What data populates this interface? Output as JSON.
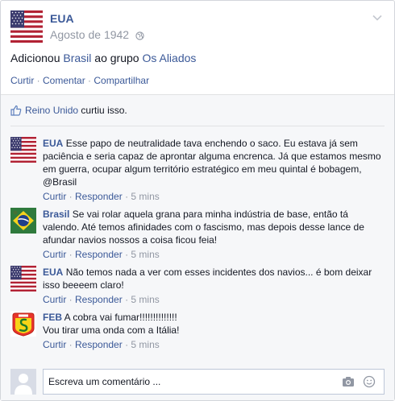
{
  "post": {
    "author": "EUA",
    "date": "Agosto de 1942",
    "story": {
      "prefix": "Adicionou",
      "friend": "Brasil",
      "middle": "ao grupo",
      "group": "Os Aliados"
    },
    "actions": {
      "like": "Curtir",
      "sep": " · ",
      "comment": "Comentar",
      "share": "Compartilhar"
    }
  },
  "likes": {
    "name": "Reino Unido",
    "suffix": "curtiu isso."
  },
  "comments": [
    {
      "author": "EUA",
      "text": "Esse papo de neutralidade tava enchendo o saco. Eu estava já sem paciência e seria capaz de aprontar alguma encrenca. Já que estamos mesmo em guerra, ocupar algum território estratégico em meu quintal é bobagem, @Brasil",
      "like": "Curtir",
      "reply": "Responder",
      "time": "5 mins"
    },
    {
      "author": "Brasil",
      "text": "Se vai rolar aquela grana para minha indústria de base, então tá valendo. Até temos afinidades com o fascismo, mas depois desse lance de afundar navios nossos a coisa ficou feia!",
      "like": "Curtir",
      "reply": "Responder",
      "time": "5 mins"
    },
    {
      "author": "EUA",
      "text": "Não temos nada a ver com esses incidentes dos navios... é bom deixar isso beeeem claro!",
      "like": "Curtir",
      "reply": "Responder",
      "time": "5 mins"
    },
    {
      "author": "FEB",
      "text_line1": "A cobra vai fumar!!!!!!!!!!!!!!",
      "text_line2": "Vou tirar uma onda com a Itália!",
      "like": "Curtir",
      "reply": "Responder",
      "time": "5 mins"
    }
  ],
  "composer": {
    "placeholder": "Escreva um comentário ..."
  },
  "colors": {
    "link": "#3b5998",
    "meta": "#9197a3",
    "ufi_bg": "#f6f7f9"
  },
  "icons": [
    "usa-flag-avatar",
    "brazil-flag-avatar",
    "feb-badge-avatar",
    "globe-icon",
    "chevron-down-icon",
    "like-thumb-icon",
    "camera-icon",
    "emoji-icon"
  ]
}
